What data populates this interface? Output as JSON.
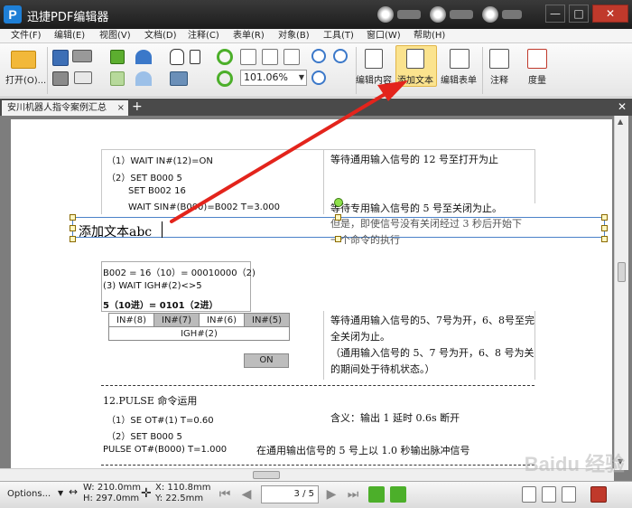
{
  "app": {
    "logo_letter": "P",
    "title": "迅捷PDF编辑器"
  },
  "window_controls": {
    "minimize": "—",
    "maximize": "□",
    "close": "✕"
  },
  "menu": [
    "文件(F)",
    "编辑(E)",
    "视图(V)",
    "文档(D)",
    "注释(C)",
    "表单(R)",
    "对象(B)",
    "工具(T)",
    "窗口(W)",
    "帮助(H)"
  ],
  "toolbar": {
    "open_label": "打开(O)...",
    "zoom_value": "101.06%",
    "edit_content_label": "编辑内容",
    "add_text_label": "添加文本",
    "edit_form_label": "编辑表单",
    "annotation_label": "注释",
    "measure_label": "度量"
  },
  "tab": {
    "title": "安川机器人指令案例汇总",
    "close": "×",
    "add": "+"
  },
  "document": {
    "line1": "（1）WAIT IN#(12)=ON",
    "line1_note": "等待通用输入信号的 12 号至打开为止",
    "line2": "（2）SET B000 5",
    "line3": "SET B002 16",
    "line4": "WAIT SIN#(B000)=B002 T=3.000",
    "line4_note": "等待专用输入信号的 5 号至关闭为止。",
    "overlay_note_a": "但是，即使信号没有关闭经过 3 秒后开始下",
    "overlay_note_b": "一个命令的执行",
    "edit_text": "添加文本abc",
    "box_line1": "B002 = 16（10）= 00010000（2)",
    "box_line2": "(3) WAIT IGH#(2)<>5",
    "box_line3": "5（10进）= 0101（2进）",
    "io_headers": [
      "IN#(8)",
      "IN#(7)",
      "IN#(6)",
      "IN#(5)"
    ],
    "io_group": "IGH#(2)",
    "on_button": "ON",
    "note_a1": "等待通用输入信号的5、7号为开，6、8号至完",
    "note_a2": "全关闭为止。",
    "note_b1": "（通用输入信号的 5、7 号为开，6、8 号为关",
    "note_b2": "的期间处于待机状态。）",
    "pulse_title": "12.PULSE 命令运用",
    "pulse1": "（1）SE OT#(1)      T=0.60",
    "pulse1_note": "含义：输出 1 延时 0.6s 断开",
    "pulse2": "（2）SET B000 5",
    "pulse3": "PULSE OT#(B000) T=1.000",
    "pulse3_note": "在通用输出信号的 5 号上以 1.0 秒输出脉冲信号"
  },
  "status": {
    "options": "Options...",
    "width": "W: 210.0mm",
    "height": "H: 297.0mm",
    "x": "X:  110.8mm",
    "y": "Y:   22.5mm",
    "page": "3",
    "page_total": "/ 5"
  },
  "watermark": "Baidu 经验",
  "colors": {
    "highlight": "#fbe38e",
    "arrow": "#e3241c",
    "selection": "#4b82c9"
  }
}
